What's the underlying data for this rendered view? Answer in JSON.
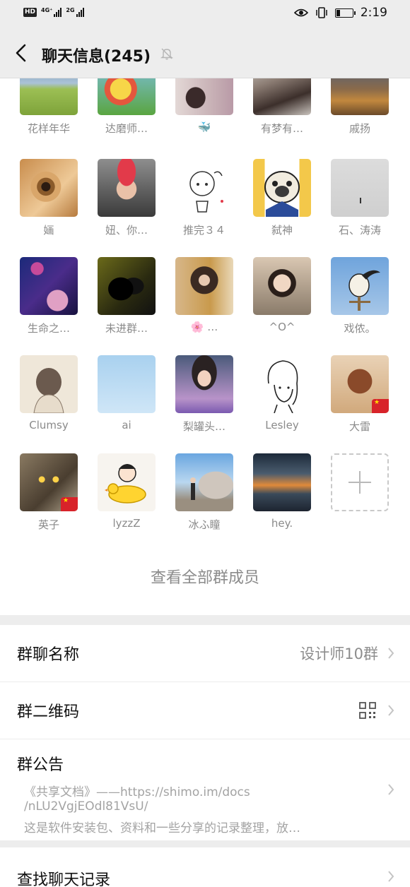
{
  "status_bar": {
    "hd": "HD",
    "net1_label": "4G⁺",
    "net2_label": "2G",
    "time": "2:19"
  },
  "nav": {
    "title": "聊天信息(245)"
  },
  "members": [
    {
      "name": "花样年华"
    },
    {
      "name": "达磨师…"
    },
    {
      "name": "🐳"
    },
    {
      "name": "有梦有…"
    },
    {
      "name": "戚扬"
    },
    {
      "name": "婳"
    },
    {
      "name": "妞、你…"
    },
    {
      "name": "推完３４"
    },
    {
      "name": "弑神"
    },
    {
      "name": "石、涛涛"
    },
    {
      "name": "生命之…"
    },
    {
      "name": "未进群…"
    },
    {
      "name": "🌸 …"
    },
    {
      "name": "^O^"
    },
    {
      "name": "戏侬。"
    },
    {
      "name": "Clumsy"
    },
    {
      "name": "ai"
    },
    {
      "name": "梨罐头…"
    },
    {
      "name": "Lesley"
    },
    {
      "name": "大雷"
    },
    {
      "name": "英子"
    },
    {
      "name": "lyzzZ"
    },
    {
      "name": "冰ふ瞳"
    },
    {
      "name": "hey."
    }
  ],
  "view_all_label": "查看全部群成员",
  "settings": {
    "group_name_label": "群聊名称",
    "group_name_value": "设计师10群",
    "qr_label": "群二维码",
    "notice_label": "群公告",
    "notice_line1": "《共享文档》——https://shimo.im/docs",
    "notice_line2": "/nLU2VgjEOdl81VsU/",
    "notice_line3": "这是软件安装包、资料和一些分享的记录整理，放…",
    "search_label": "查找聊天记录"
  },
  "colors": {
    "background": "#ededed",
    "card": "#ffffff",
    "secondary_text": "#8d8d8d"
  }
}
